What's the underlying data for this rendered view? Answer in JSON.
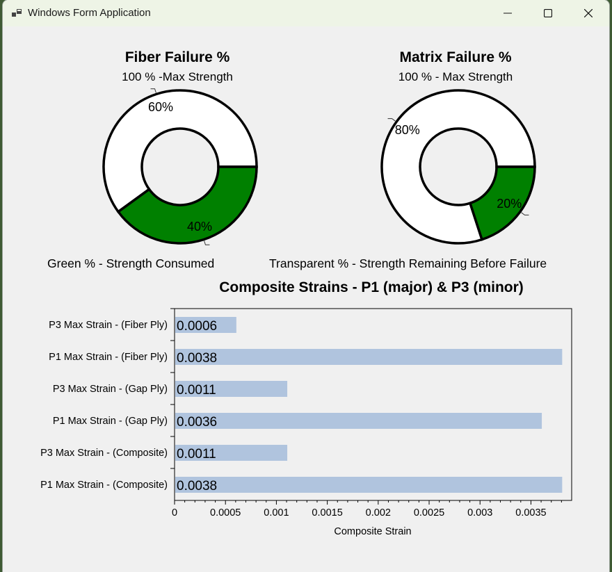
{
  "window": {
    "title": "Windows Form Application",
    "controls": [
      "minimize-icon",
      "maximize-icon",
      "close-icon"
    ]
  },
  "fiber_chart": {
    "title": "Fiber Failure %",
    "subtitle": "100 % -Max Strength",
    "caption": "Green % - Strength Consumed"
  },
  "matrix_chart": {
    "title": "Matrix Failure %",
    "subtitle": "100 % - Max Strength",
    "caption": "Transparent % - Strength Remaining Before Failure"
  },
  "strain_chart": {
    "title": "Composite Strains - P1 (major) & P3 (minor)",
    "xlabel": "Composite Strain"
  },
  "colors": {
    "consumed": "#008000",
    "remaining": "#ffffff",
    "bar": "#b0c4de",
    "titlebar": "#eef4e6",
    "background": "#f0f0f0"
  },
  "chart_data": [
    {
      "type": "pie",
      "title": "Fiber Failure %",
      "subtitle": "100 % -Max Strength",
      "labels": [
        "60%",
        "40%"
      ],
      "values": [
        60,
        40
      ],
      "colors": [
        "#ffffff",
        "#008000"
      ]
    },
    {
      "type": "pie",
      "title": "Matrix Failure %",
      "subtitle": "100 % - Max Strength",
      "labels": [
        "80%",
        "20%"
      ],
      "values": [
        80,
        20
      ],
      "colors": [
        "#ffffff",
        "#008000"
      ]
    },
    {
      "type": "bar",
      "orientation": "horizontal",
      "title": "Composite Strains - P1 (major) & P3 (minor)",
      "xlabel": "Composite Strain",
      "categories": [
        "P3 Max Strain - (Fiber Ply)",
        "P1 Max Strain - (Fiber Ply)",
        "P3 Max Strain - (Gap Ply)",
        "P1 Max Strain - (Gap Ply)",
        "P3 Max Strain - (Composite)",
        "P1 Max Strain - (Composite)"
      ],
      "values": [
        0.0006,
        0.0038,
        0.0011,
        0.0036,
        0.0011,
        0.0038
      ],
      "value_labels": [
        "0.0006",
        "0.0038",
        "0.0011",
        "0.0036",
        "0.0011",
        "0.0038"
      ],
      "xticks": [
        "0",
        "0.0005",
        "0.001",
        "0.0015",
        "0.002",
        "0.0025",
        "0.003",
        "0.0035"
      ],
      "xtick_values": [
        0,
        0.0005,
        0.001,
        0.0015,
        0.002,
        0.0025,
        0.003,
        0.0035
      ],
      "xlim": [
        0,
        0.0039
      ]
    }
  ]
}
